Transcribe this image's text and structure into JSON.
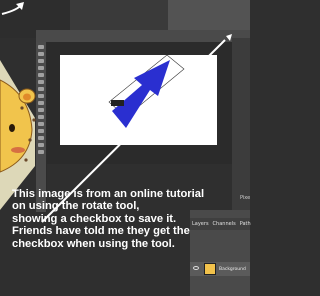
{
  "caption": {
    "lines": [
      "This image is from an online tutorial",
      "on using the rotate tool,",
      "showing a checkbox to save it.",
      "Friends have told me they get the",
      "checkbox when using the tool."
    ]
  },
  "layers_panel": {
    "tabs": [
      "Layers",
      "Channels",
      "Path"
    ],
    "layer_name": "Background"
  },
  "pixel_label": "Pixe",
  "colors": {
    "arrow_blue": "#2a2fd0",
    "arrow_annotation": "#ffffff",
    "background": "#2f2f2f"
  },
  "icons": [
    "eye-icon",
    "arrow-icon",
    "cartoon-character"
  ]
}
